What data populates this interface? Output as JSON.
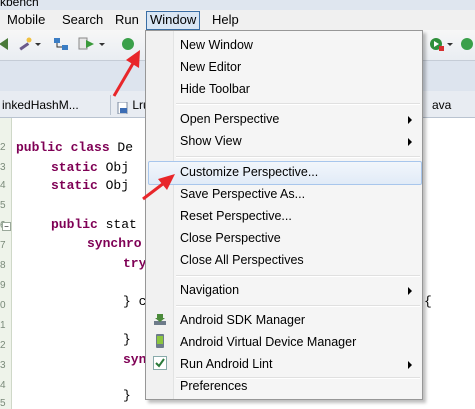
{
  "window": {
    "title": "kbench"
  },
  "menubar": {
    "items": [
      {
        "label": "Mobile"
      },
      {
        "label": "Search"
      },
      {
        "label": "Run"
      },
      {
        "label": "Window"
      },
      {
        "label": "Help"
      }
    ]
  },
  "tabs": [
    {
      "label": "inkedHashM..."
    },
    {
      "label": "Lru"
    },
    {
      "label": "ava"
    }
  ],
  "editor": {
    "line_numbers": [
      "2",
      "3",
      "4",
      "5",
      "6",
      "7",
      "8",
      "9",
      "0",
      "1",
      "2",
      "3",
      "4",
      "5"
    ],
    "lines": [
      {
        "kw": "public class",
        "text": " De"
      },
      {
        "kw": "static",
        "text": " Obj"
      },
      {
        "kw": "static",
        "text": " Obj"
      },
      {
        "kw": "public",
        "text": " stat"
      },
      {
        "kw": "synchro",
        "text": ""
      },
      {
        "kw": "try",
        "text": ""
      },
      {
        "kw": "",
        "text": "} c"
      },
      {
        "kw": "",
        "text": "}"
      },
      {
        "kw": "syn",
        "text": ""
      },
      {
        "kw": "",
        "text": "}"
      }
    ],
    "right_fragment": "{"
  },
  "window_menu": {
    "items": [
      {
        "label": "New Window",
        "submenu": false
      },
      {
        "label": "New Editor",
        "submenu": false
      },
      {
        "label": "Hide Toolbar",
        "submenu": false
      },
      {
        "label": "Open Perspective",
        "submenu": true
      },
      {
        "label": "Show View",
        "submenu": true
      },
      {
        "label": "Customize Perspective...",
        "submenu": false,
        "highlighted": true
      },
      {
        "label": "Save Perspective As...",
        "submenu": false
      },
      {
        "label": "Reset Perspective...",
        "submenu": false
      },
      {
        "label": "Close Perspective",
        "submenu": false
      },
      {
        "label": "Close All Perspectives",
        "submenu": false
      },
      {
        "label": "Navigation",
        "submenu": true
      },
      {
        "label": "Android SDK Manager",
        "submenu": false,
        "icon": "download-icon"
      },
      {
        "label": "Android Virtual Device Manager",
        "submenu": false,
        "icon": "android-device-icon"
      },
      {
        "label": "Run Android Lint",
        "submenu": true,
        "icon": "checkmark-icon"
      },
      {
        "label": "Preferences",
        "submenu": false
      }
    ]
  },
  "colors": {
    "annotation_arrow": "#e8262a",
    "keyword": "#7f0055",
    "highlight_border": "#a8c6ec"
  }
}
